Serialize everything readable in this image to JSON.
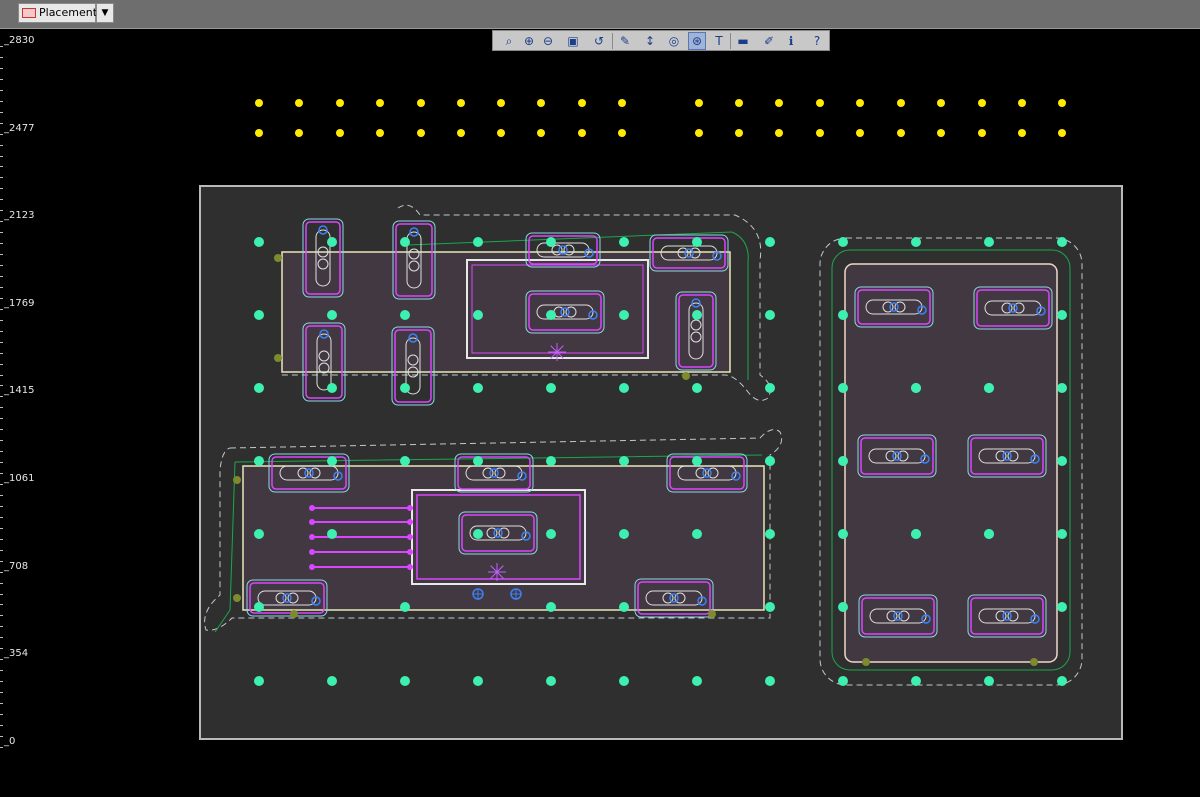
{
  "toolbar_top": {
    "mode_label": "Placement",
    "dropdown_arrow": "▼"
  },
  "ruler": {
    "labels": [
      "2830",
      "2477",
      "2123",
      "1769",
      "1415",
      "1061",
      "708",
      "354",
      "0"
    ]
  },
  "view_toolbar": {
    "icons": [
      "zoom-fit-icon",
      "zoom-in-icon",
      "zoom-out-icon",
      "zoom-window-icon",
      "zoom-previous-icon",
      "highlight-icon",
      "measure-icon",
      "snap-icon",
      "grid-display-icon",
      "text-icon",
      "layer-icon",
      "color-icon",
      "info-icon",
      "help-icon"
    ],
    "glyphs": [
      "⌕",
      "⊕",
      "⊖",
      "▣",
      "↺",
      "✎",
      "↕",
      "◎",
      "⊛",
      "T",
      "▬",
      "✐",
      "ℹ",
      "?"
    ]
  },
  "colors": {
    "background": "#000000",
    "board_fill": "#2f2f2f",
    "board_outline": "#b9b9b9",
    "pin_yellow": "#ffeb00",
    "pin_teal": "#3df0b0",
    "part_fill": "#453a44",
    "pad_outline": "#d946ff",
    "keepout": "#bfc7d0",
    "path_green": "#1aa84b"
  }
}
